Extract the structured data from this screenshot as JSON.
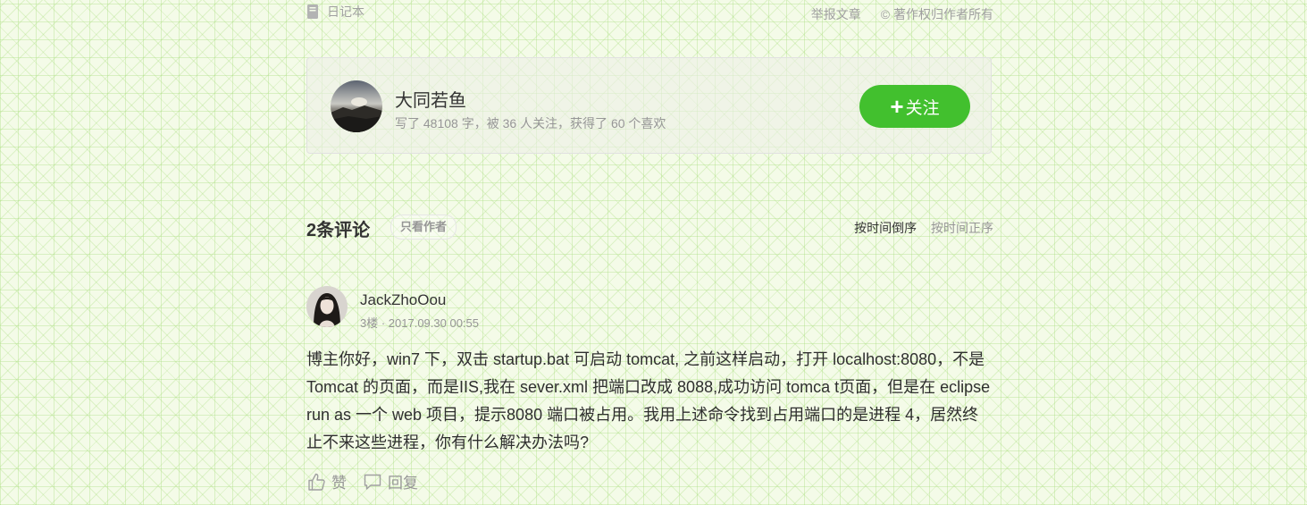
{
  "meta": {
    "notebook_label": "日记本",
    "report_label": "举报文章",
    "copyright_label": "© 著作权归作者所有"
  },
  "author_card": {
    "name": "大同若鱼",
    "stats": "写了 48108 字，被 36 人关注，获得了 60 个喜欢",
    "follow_label": "关注",
    "follow_plus": "+",
    "accent_color": "#42c02e"
  },
  "comments": {
    "count_label": "2条评论",
    "author_only_label": "只看作者",
    "sort_desc_label": "按时间倒序",
    "sort_asc_label": "按时间正序",
    "items": [
      {
        "user": "JackZhoOou",
        "meta": "3楼 · 2017.09.30 00:55",
        "body": "博主你好，win7 下，双击 startup.bat 可启动 tomcat, 之前这样启动，打开 localhost:8080，不是 Tomcat 的页面，而是IIS,我在 sever.xml 把端口改成 8088,成功访问 tomca t页面，但是在 eclipse run as 一个 web 项目，提示8080 端口被占用。我用上述命令找到占用端口的是进程 4，居然终止不来这些进程，你有什么解决办法吗?",
        "like_label": "赞",
        "reply_label": "回复"
      }
    ]
  }
}
